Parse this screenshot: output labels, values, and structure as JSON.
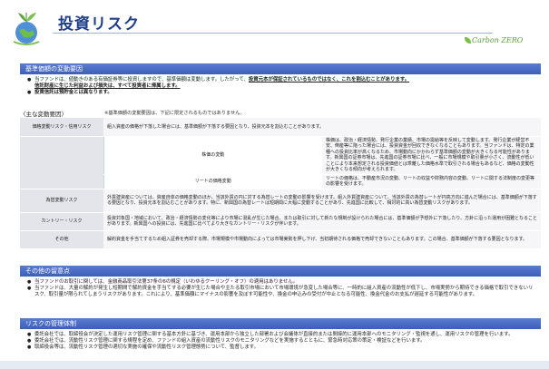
{
  "header": {
    "title": "投資リスク",
    "brand": "Carbon ZERO"
  },
  "sec1": {
    "title": "基準価額の変動要因",
    "b1_part1": "当ファンドは、値動きのある有価証券等に投資しますので、基準価額は変動します。したがって、",
    "b1_bold": "投資元本が保証されているものではなく、これを割込むことがあります。",
    "b1_bold2": "信託財産に生じた利益および損失は、すべて投資者に帰属します。",
    "b2": "投資信託は預貯金とは異なります。"
  },
  "risk": {
    "heading": "〈主な変動要因〉",
    "note": "※基準価額の変動要因は、下記に限定されるものではありません。",
    "rows": [
      {
        "label": "価格変動リスク・信用リスク",
        "text": "組入資産の価格が下落した場合には、基準価額が下落する要因となり、投資元本を割込むことがあります。"
      },
      {
        "label": "株価の変動",
        "text": "株価は、政治・経済情勢、発行企業の業績、市場の需給等を反映して変動します。発行企業が経営不安、倒産等に陥った場合には、投資資金が回収できなくなることもあります。当ファンドは、特定の業種への投資比率が高くなるため、市場動向にかかわらず基準価額の変動が大きくなる可能性があります。新興国の証券市場は、先進国の証券市場に比べ、一般に市場規模や取引量が小さく、流動性が低いことにより本来想定される投資価値とは乖離した価格水準で取引される場合もあるなど、価格の変動性が大きくなる傾向が考えられます。"
      },
      {
        "label": "リートの価格変動",
        "text": "リートの価格は、不動産市況の変動、リートの収益や財務内容の変動、リートに関する法制度の変更等の影響を受けます。"
      },
      {
        "label": "為替変動リスク",
        "text": "外貨建資産については、資産自体の価格変動のほか、当該外貨の円に対する為替レートの変動の影響を受けます。組入外貨建資産について、当該外貨の為替レートが円高方向に進んだ場合には、基準価額が下落する要因となり、投資元本を割込むことがあります。特に、新興国の為替レートは短期間に大幅に変動することがあり、先進国に比較して、相対的に高い為替変動リスクがあります。"
      },
      {
        "label": "カントリー・リスク",
        "text": "投資対象国・地域において、政治・経済情勢の変化等により市場に混乱が生じた場合、または取引に対して新たな規制が設けられた場合には、基準価額が予想外に下落したり、方針に沿った運用が困難となることがあります。新興国への投資には、先進国に比べてより大きなカントリー・リスクが伴います。"
      },
      {
        "label": "その他",
        "text": "解約資金を手当てするため組入証券を売却する際、市場規模や市場動向によっては市場実勢を押し下げ、当初期待される価格で売却できないこともあります。この場合、基準価額が下落する要因となります。"
      }
    ]
  },
  "sec2": {
    "title": "その他の留意点",
    "b1": "当ファンドのお取引に関しては、金融商品取引法第37条の6の規定（いわゆるクーリング・オフ）の適用はありません。",
    "b2": "当ファンドは、大量の解約が発生し短期間で解約資金を手当てする必要が生じた場合や主たる取引市場において市場環境が急変した場合等に、一時的に組入資産の流動性が低下し、市場実勢から期待できる価格で取引できないリスク、取引量が限られてしまうリスクがあります。これにより、基準価額にマイナスの影響を及ぼす可能性や、換金の申込みの受付が中止となる可能性、換金代金のお支払が遅延する可能性があります。"
  },
  "sec3": {
    "title": "リスクの管理体制",
    "b1": "委託会社では、取締役会が決定した運用リスク管理に関する基本方針に基づき、運用本部から独立した部署および会議体が直接的または間接的に運用本部へのモニタリング・監視を通し、運用リスクの管理を行います。",
    "b2": "委託会社では、流動性リスク管理に関する規程を定め、ファンドの組入資産の流動性リスクのモニタリングなどを実施するとともに、緊急時対応策の策定・検証などを行います。",
    "b3": "取締役会等は、流動性リスク管理の適切な実施の確保や流動性リスク管理態勢について、監督します。"
  },
  "colors": {
    "title": "#1f3f8a",
    "bar": "#3c5fb8",
    "brand": "#5a9e3a"
  },
  "icons": {
    "logo": "globe-plant-logo"
  }
}
